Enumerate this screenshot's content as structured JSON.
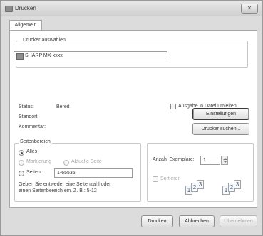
{
  "window": {
    "title": "Drucken",
    "close_glyph": "✕"
  },
  "tabs": [
    {
      "label": "Allgemein"
    }
  ],
  "printer_group": {
    "label": "Drucker auswählen",
    "selected_printer": "SHARP MX-xxxx"
  },
  "status": {
    "status_label": "Status:",
    "status_value": "Bereit",
    "location_label": "Standort:",
    "location_value": "",
    "comment_label": "Kommentar:",
    "comment_value": ""
  },
  "print_to_file": {
    "label": "Ausgabe in Datei umleiten",
    "checked": false
  },
  "buttons": {
    "settings": "Einstellungen",
    "find_printer": "Drucker suchen...",
    "print": "Drucken",
    "cancel": "Abbrechen",
    "apply": "Übernehmen"
  },
  "page_range": {
    "label": "Seitenbereich",
    "options": [
      {
        "label": "Alles",
        "selected": true,
        "enabled": true
      },
      {
        "label": "Markierung",
        "selected": false,
        "enabled": false
      },
      {
        "label": "Aktuelle Seite",
        "selected": false,
        "enabled": false
      },
      {
        "label": "Seiten:",
        "selected": false,
        "enabled": true
      }
    ],
    "pages_value": "1-65535",
    "hint_line1": "Geben Sie entweder eine Seitenzahl oder",
    "hint_line2": "einen Seitenbereich ein. Z. B.: 5-12"
  },
  "copies": {
    "label": "Anzahl Exemplare:",
    "value": "1",
    "collate_label": "Sortieren",
    "collate_checked": true,
    "collate_enabled": false,
    "sheet_digits": [
      "1",
      "2",
      "3"
    ]
  },
  "icons": {
    "app": "printer-icon",
    "close": "close-icon",
    "printer_item": "printer-icon",
    "spinner": "spinner-arrows-icon",
    "collate": "collate-pages-icon"
  }
}
